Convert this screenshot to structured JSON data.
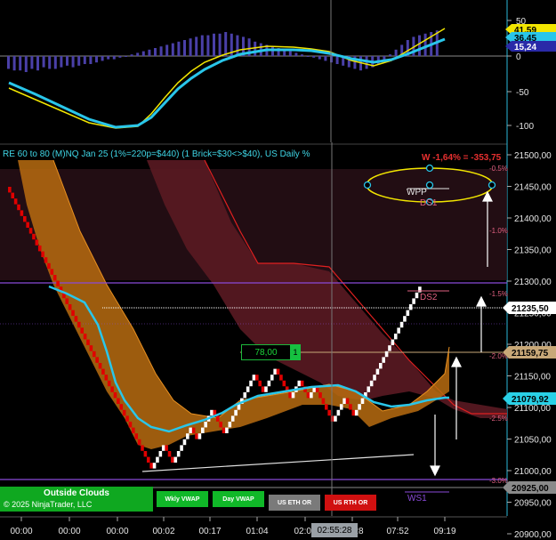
{
  "header": {
    "title": "RE 60 to 80 (M)NQ Jan 25 (1%=220p=$440) (1 Brick=$30<>$40), US Daily %"
  },
  "w_label": "W -1,64% = -353,75",
  "levels": {
    "wpp": "WPP",
    "ds1": "DS1",
    "ds2": "DS2",
    "ws1": "WS1"
  },
  "percent_labels": [
    "-0.5%",
    "-1.0%",
    "-1.5%",
    "-2.0%",
    "-2.5%",
    "-3.0%"
  ],
  "top_axis": {
    "ticks": [
      "50",
      "0",
      "-50",
      "-100"
    ],
    "tags": [
      {
        "text": "41,59",
        "color": "#f2e600",
        "fg": "#000"
      },
      {
        "text": "36,45",
        "color": "#29c6ea",
        "fg": "#000"
      },
      {
        "text": "15,24",
        "color": "#2a2aa8",
        "fg": "#fff"
      }
    ]
  },
  "price_axis": {
    "ticks": [
      "21500,00",
      "21450,00",
      "21400,00",
      "21350,00",
      "21300,00",
      "21250,00",
      "21200,00",
      "21150,00",
      "21100,00",
      "21050,00",
      "21000,00",
      "20950,00",
      "20900,00"
    ],
    "tags": [
      {
        "text": "21235,50",
        "color": "#ffffff",
        "fg": "#000"
      },
      {
        "text": "21159,75",
        "color": "#c8a878",
        "fg": "#000"
      },
      {
        "text": "21079,92",
        "color": "#29d0e6",
        "fg": "#000"
      },
      {
        "text": "20925,00",
        "color": "#8a8a8a",
        "fg": "#000"
      }
    ]
  },
  "time_axis": {
    "ticks": [
      "00:00",
      "00:00",
      "00:00",
      "00:02",
      "00:17",
      "01:04",
      "02:03",
      "05:28",
      "07:52",
      "09:19"
    ],
    "current": "02:55:28"
  },
  "buttons": {
    "outside_title": "Outside Clouds",
    "copyright": "© 2025 NinjaTrader, LLC",
    "wkly_vwap": "Wkly VWAP",
    "day_vwap": "Day VWAP",
    "us_eth_or": "US ETH OR",
    "us_rth_or": "US RTH OR",
    "left_symbol": "/\\"
  },
  "box_value": "78,00",
  "box_button": "1",
  "colors": {
    "oscillator_cyan": "#29c6ea",
    "oscillator_yellow": "#f2e600",
    "histogram": "#4a40a8",
    "brick_up": "#ffffff",
    "brick_down": "#e00000",
    "cloud_orange": "#c87810",
    "red_zone": "#5a1a22",
    "purple_line": "#8a4ad8",
    "bg": "#000000"
  }
}
